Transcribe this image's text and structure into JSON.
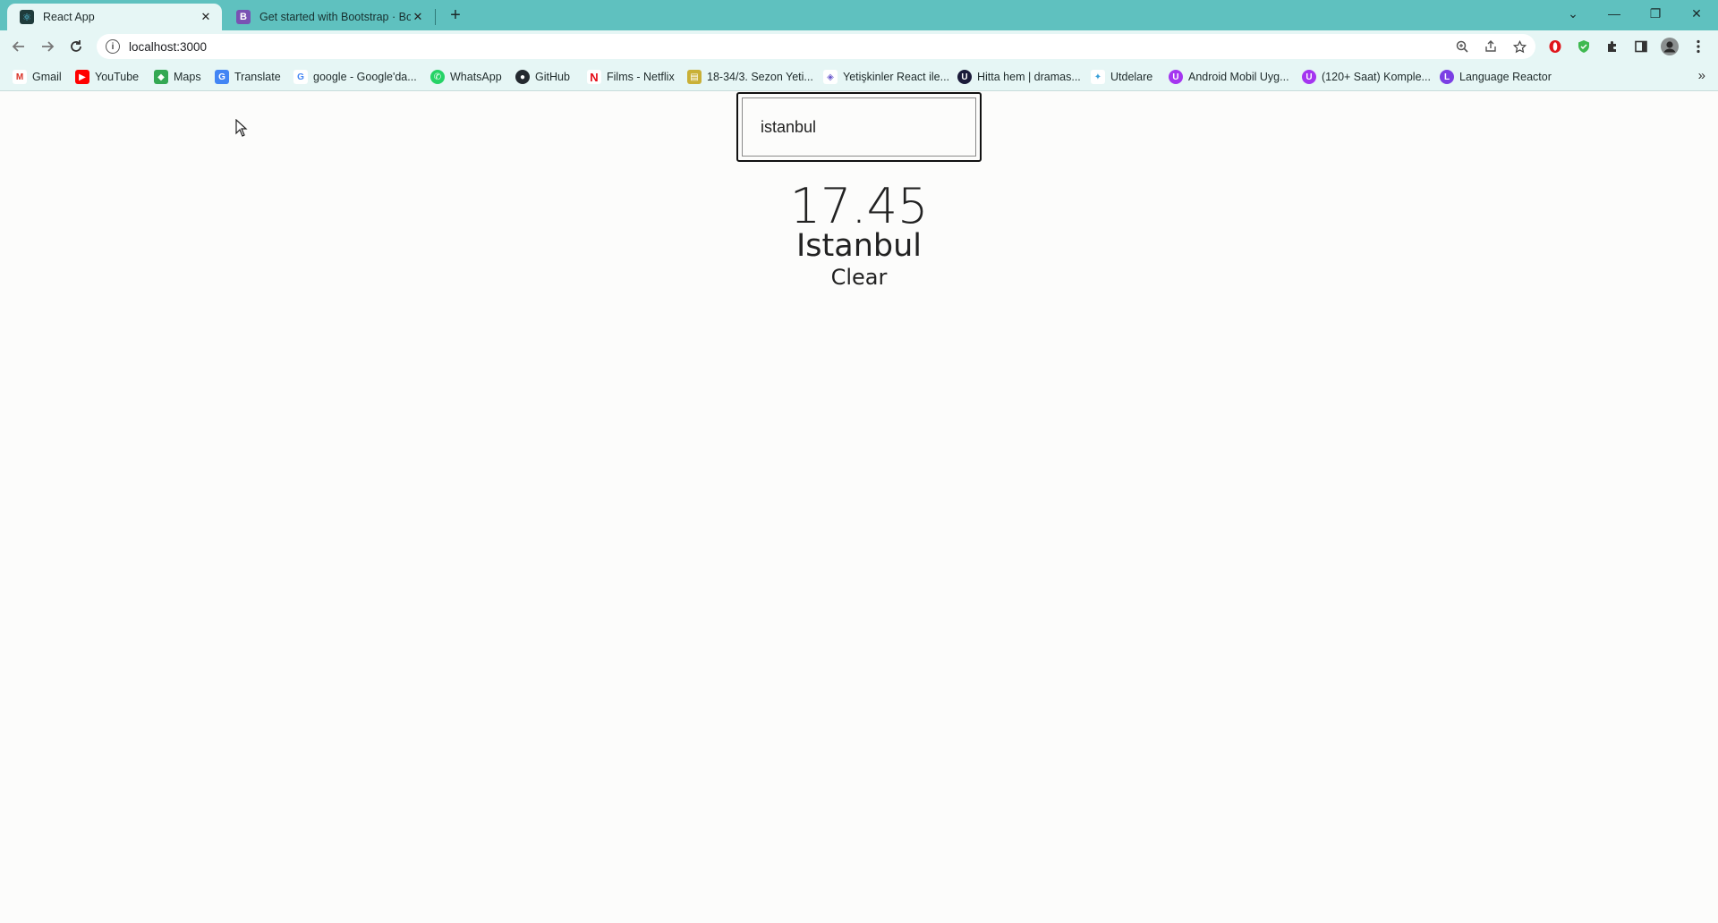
{
  "browser": {
    "tabs": [
      {
        "title": "React App",
        "active": true
      },
      {
        "title": "Get started with Bootstrap · Boot",
        "active": false
      }
    ],
    "new_tab": "+",
    "window_controls": {
      "list": "⌄",
      "minimize": "—",
      "maximize": "❐",
      "close": "✕"
    },
    "address_bar": {
      "url": "localhost:3000",
      "info_icon": "i"
    },
    "bookmarks": [
      {
        "label": "Gmail",
        "icon": "gmail-icon",
        "color": "#d93025"
      },
      {
        "label": "YouTube",
        "icon": "youtube-icon",
        "color": "#ff0000"
      },
      {
        "label": "Maps",
        "icon": "maps-icon",
        "color": "#34a853"
      },
      {
        "label": "Translate",
        "icon": "translate-icon",
        "color": "#4285f4"
      },
      {
        "label": "google - Google'da...",
        "icon": "google-icon",
        "color": "#4285f4"
      },
      {
        "label": "WhatsApp",
        "icon": "whatsapp-icon",
        "color": "#25d366"
      },
      {
        "label": "GitHub",
        "icon": "github-icon",
        "color": "#24292f"
      },
      {
        "label": "Films - Netflix",
        "icon": "netflix-icon",
        "color": "#e50914"
      },
      {
        "label": "18-34/3. Sezon Yeti...",
        "icon": "folder-icon",
        "color": "#c9b037"
      },
      {
        "label": "Yetişkinler React ile...",
        "icon": "bookmark-icon",
        "color": "#6a5acd"
      },
      {
        "label": "Hitta hem | dramas...",
        "icon": "hitta-icon",
        "color": "#1b1b3a"
      },
      {
        "label": "Utdelare",
        "icon": "utdelare-icon",
        "color": "#3aa0d8"
      },
      {
        "label": "Android Mobil Uyg...",
        "icon": "udemy-icon",
        "color": "#a435f0"
      },
      {
        "label": "(120+ Saat) Komple...",
        "icon": "udemy-icon",
        "color": "#a435f0"
      },
      {
        "label": "Language Reactor",
        "icon": "language-reactor-icon",
        "color": "#7b3fe4"
      }
    ]
  },
  "app": {
    "search": {
      "value": "istanbul"
    },
    "temperature": "17.45",
    "city": "Istanbul",
    "condition": "Clear"
  }
}
